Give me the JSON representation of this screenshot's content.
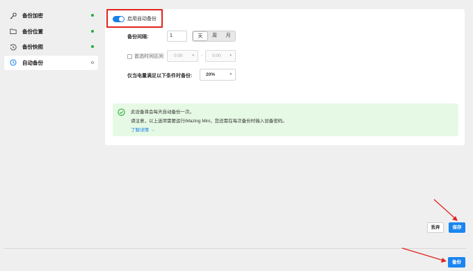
{
  "sidebar": {
    "items": [
      {
        "label": "备份加密",
        "icon": "key-icon",
        "status": "green"
      },
      {
        "label": "备份位置",
        "icon": "folder-icon",
        "status": "green"
      },
      {
        "label": "备份快照",
        "icon": "history-icon",
        "status": "green"
      },
      {
        "label": "自动备份",
        "icon": "clock-icon",
        "status": "inactive"
      }
    ]
  },
  "toggle": {
    "label": "启用自动备份",
    "enabled": true
  },
  "interval": {
    "label": "备份间隔:",
    "value": "1",
    "units": [
      "天",
      "周",
      "月"
    ],
    "selected": "天"
  },
  "time_range": {
    "label": "首选时间区间",
    "start": "0:00",
    "end": "0:00",
    "separator": "-"
  },
  "battery": {
    "label": "仅当电量满足以下条件时备份:",
    "value": "20%"
  },
  "info": {
    "line1": "此设备将会每天自动备份一次。",
    "line2": "请注意，以上选项需要运行iMazing Mini，您还需在每次备份时输入设备密码。",
    "link": "了解详情 →"
  },
  "buttons": {
    "discard": "丢弃",
    "save": "保存",
    "backup": "备份"
  },
  "colors": {
    "accent": "#1a85f0",
    "highlight": "#e0231e",
    "success": "#2aaa3c"
  }
}
